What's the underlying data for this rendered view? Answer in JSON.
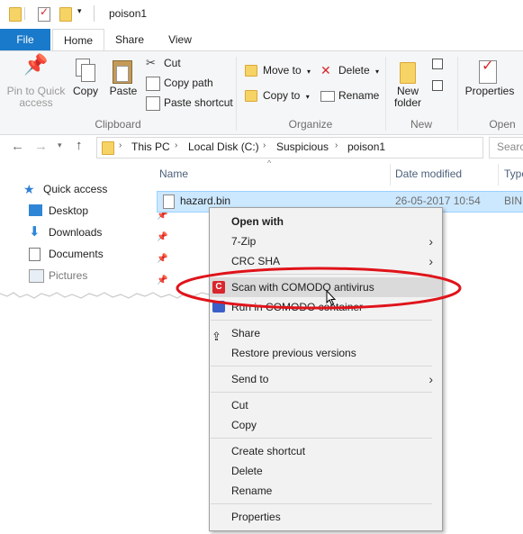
{
  "window": {
    "title": "poison1"
  },
  "ribbon_tabs": [
    "File",
    "Home",
    "Share",
    "View"
  ],
  "clipboard": {
    "pin_label_1": "Pin to Quick",
    "pin_label_2": "access",
    "copy": "Copy",
    "paste": "Paste",
    "cut": "Cut",
    "copy_path": "Copy path",
    "paste_shortcut": "Paste shortcut",
    "group": "Clipboard"
  },
  "organize": {
    "move_to": "Move to",
    "copy_to": "Copy to",
    "delete": "Delete",
    "rename": "Rename",
    "group": "Organize"
  },
  "new": {
    "new_folder_1": "New",
    "new_folder_2": "folder",
    "group": "New"
  },
  "open": {
    "properties": "Properties",
    "group": "Open"
  },
  "address": {
    "crumbs": [
      "This PC",
      "Local Disk (C:)",
      "Suspicious",
      "poison1"
    ],
    "search_placeholder": "Searc"
  },
  "nav_pane": {
    "quick_access": "Quick access",
    "items": [
      "Desktop",
      "Downloads",
      "Documents",
      "Pictures"
    ]
  },
  "columns": {
    "name": "Name",
    "date_modified": "Date modified",
    "type": "Type"
  },
  "file": {
    "name": "hazard.bin",
    "date": "26-05-2017 10:54",
    "type": "BIN"
  },
  "context_menu": {
    "open_with": "Open with",
    "seven_zip": "7-Zip",
    "crc_sha": "CRC SHA",
    "scan_comodo": "Scan with COMODO antivirus",
    "run_comodo": "Run in COMODO container",
    "share": "Share",
    "restore": "Restore previous versions",
    "send_to": "Send to",
    "cut": "Cut",
    "copy": "Copy",
    "create_shortcut": "Create shortcut",
    "delete": "Delete",
    "rename": "Rename",
    "properties": "Properties"
  },
  "colors": {
    "accent": "#1979ca",
    "highlight": "#cce8ff",
    "annotation": "#e0131a"
  }
}
